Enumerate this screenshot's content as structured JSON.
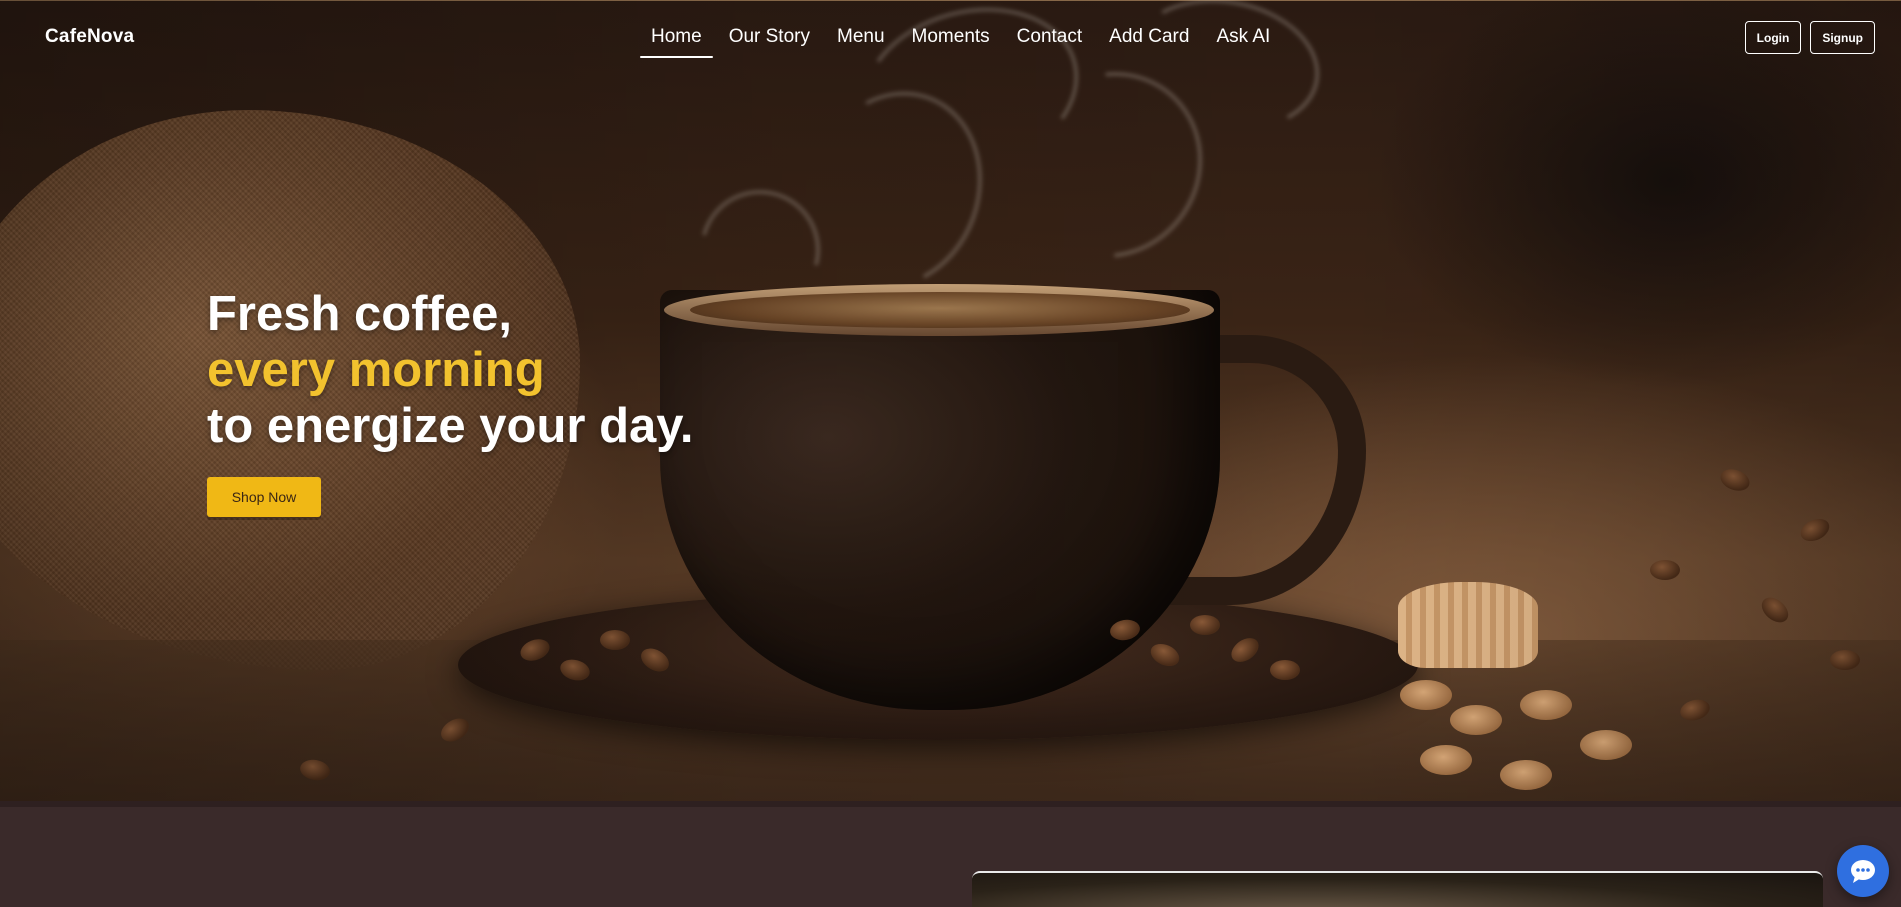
{
  "navbar": {
    "brand": "CafeNova",
    "links": [
      {
        "label": "Home",
        "active": true
      },
      {
        "label": "Our Story"
      },
      {
        "label": "Menu"
      },
      {
        "label": "Moments"
      },
      {
        "label": "Contact"
      },
      {
        "label": "Add Card"
      },
      {
        "label": "Ask AI"
      }
    ],
    "login_label": "Login",
    "signup_label": "Signup"
  },
  "hero": {
    "line1": "Fresh coffee,",
    "line2": "every morning",
    "line3": "to energize your day.",
    "cta_label": "Shop Now"
  },
  "chat": {
    "icon": "chat-bubble-icon"
  },
  "colors": {
    "accent": "#f2c22e",
    "cta": "#f0b815",
    "section_bg": "#3a2a2a",
    "chat_fab": "#2f6fe0"
  }
}
